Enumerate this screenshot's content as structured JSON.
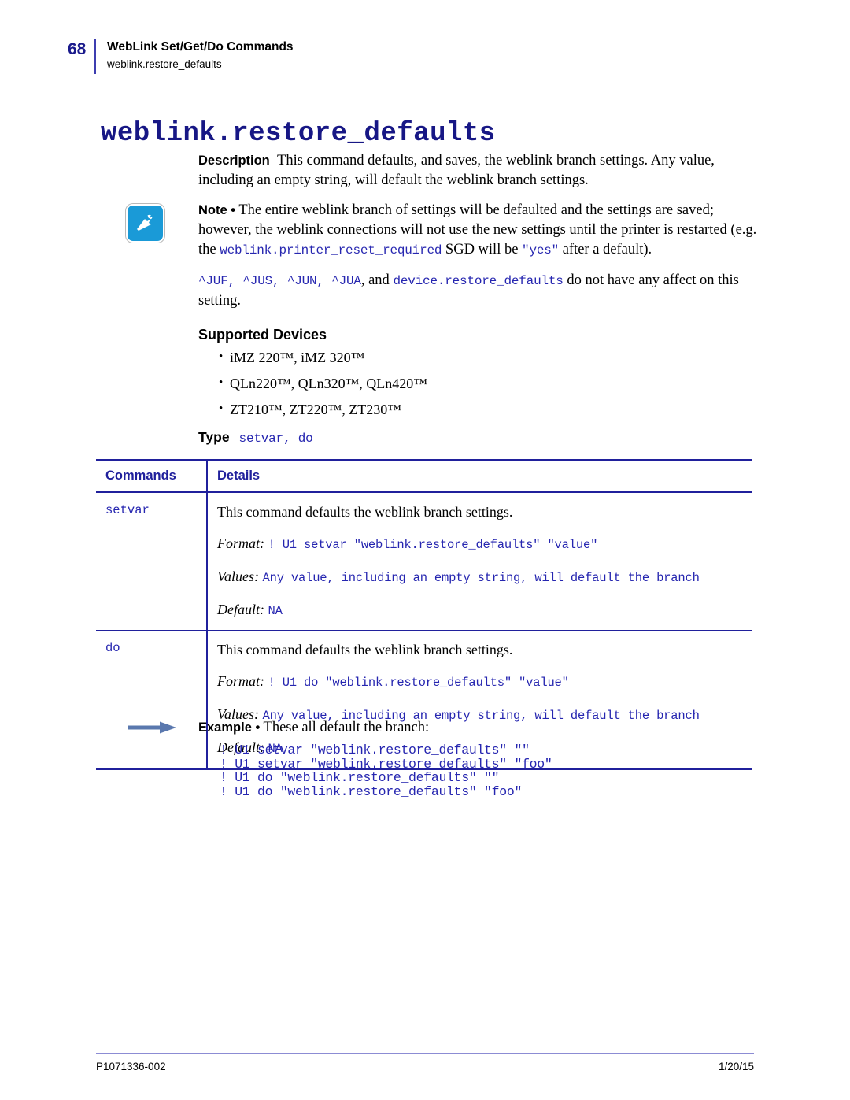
{
  "header": {
    "page_number": "68",
    "title": "WebLink Set/Get/Do Commands",
    "subtitle": "weblink.restore_defaults"
  },
  "doc_title": "weblink.restore_defaults",
  "description": {
    "label": "Description",
    "text": "This command defaults, and saves, the weblink branch settings. Any value, including an empty string, will default the weblink branch settings."
  },
  "note": {
    "icon": "zebra-note-icon",
    "label": "Note •",
    "text_part1": "The entire weblink branch of settings will be defaulted and the settings are saved; however, the weblink connections will not use the new settings until the printer is restarted (e.g. the ",
    "code1": "weblink.printer_reset_required",
    "text_part2": " SGD will be ",
    "code2": "\"yes\"",
    "text_part3": " after a default)."
  },
  "affect_note": {
    "code1": "^JUF, ^JUS, ^JUN, ^JUA",
    "text1": ", and ",
    "code2": "device.restore_defaults",
    "text2": " do not have any affect on this setting."
  },
  "supported_devices": {
    "heading": "Supported Devices",
    "items": [
      {
        "names": "iMZ 220™, iMZ 320™"
      },
      {
        "names": "QLn220™, QLn320™, QLn420™"
      },
      {
        "names": "ZT210™, ZT220™, ZT230™"
      }
    ]
  },
  "type": {
    "label": "Type",
    "value": "setvar, do"
  },
  "table": {
    "columns": [
      "Commands",
      "Details"
    ],
    "rows": [
      {
        "command": "setvar",
        "description": "This command defaults the weblink branch settings.",
        "format_label": "Format:",
        "format_value": "! U1 setvar \"weblink.restore_defaults\" \"value\"",
        "values_label": "Values:",
        "values_value": "Any value, including an empty string, will default the branch",
        "default_label": "Default:",
        "default_value": "NA"
      },
      {
        "command": "do",
        "description": "This command defaults the weblink branch settings.",
        "format_label": "Format:",
        "format_value": "! U1 do \"weblink.restore_defaults\" \"value\"",
        "values_label": "Values:",
        "values_value": "Any value, including an empty string, will default the branch",
        "default_label": "Default:",
        "default_value": "NA"
      }
    ]
  },
  "example": {
    "icon": "right-arrow-icon",
    "label": "Example •",
    "text": "These all default the branch:",
    "code": "! U1 setvar \"weblink.restore_defaults\" \"\"\n! U1 setvar \"weblink.restore_defaults\" \"foo\"\n! U1 do \"weblink.restore_defaults\" \"\"\n! U1 do \"weblink.restore_defaults\" \"foo\""
  },
  "footer": {
    "document_id": "P1071336-002",
    "date": "1/20/15"
  },
  "colors": {
    "title_blue": "#171785",
    "code_blue": "#2626b0",
    "table_rule": "#20209c",
    "note_icon_bg": "#1a9ad7",
    "arrow": "#5a78ae",
    "footer_rule": "#8c8cd4"
  }
}
